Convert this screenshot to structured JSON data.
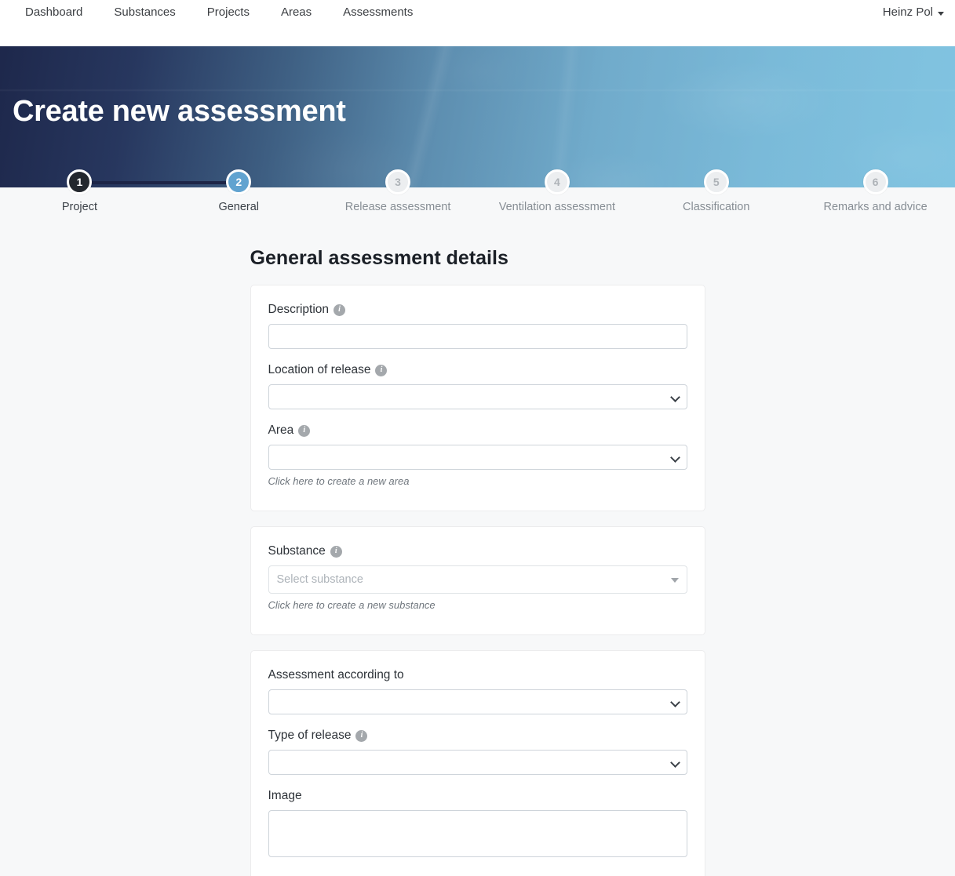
{
  "nav": {
    "items": [
      {
        "label": "Dashboard",
        "name": "nav-link-dashboard"
      },
      {
        "label": "Substances",
        "name": "nav-link-substances"
      },
      {
        "label": "Projects",
        "name": "nav-link-projects"
      },
      {
        "label": "Areas",
        "name": "nav-link-areas"
      },
      {
        "label": "Assessments",
        "name": "nav-link-assessments"
      }
    ],
    "user": "Heinz Pol",
    "user_caret_icon": "caret-down-icon"
  },
  "hero": {
    "title": "Create new assessment"
  },
  "stepper": {
    "steps": [
      {
        "number": "1",
        "label": "Project",
        "state": "done"
      },
      {
        "number": "2",
        "label": "General",
        "state": "active"
      },
      {
        "number": "3",
        "label": "Release assessment",
        "state": "todo"
      },
      {
        "number": "4",
        "label": "Ventilation assessment",
        "state": "todo"
      },
      {
        "number": "5",
        "label": "Classification",
        "state": "todo"
      },
      {
        "number": "6",
        "label": "Remarks and advice",
        "state": "todo"
      }
    ]
  },
  "main": {
    "page_title": "General assessment details",
    "card1": {
      "description": {
        "label": "Description",
        "info_icon": "info-icon",
        "value": ""
      },
      "location_of_release": {
        "label": "Location of release",
        "info_icon": "info-icon",
        "value": "",
        "chevron_icon": "chevron-down-icon"
      },
      "area": {
        "label": "Area",
        "info_icon": "info-icon",
        "value": "",
        "chevron_icon": "chevron-down-icon",
        "helper": "Click here to create a new area"
      }
    },
    "card2": {
      "substance": {
        "label": "Substance",
        "info_icon": "info-icon",
        "placeholder": "Select substance",
        "arrow_icon": "triangle-down-icon",
        "helper": "Click here to create a new substance"
      }
    },
    "card3": {
      "assessment_according_to": {
        "label": "Assessment according to",
        "value": "",
        "chevron_icon": "chevron-down-icon"
      },
      "type_of_release": {
        "label": "Type of release",
        "info_icon": "info-icon",
        "value": "",
        "chevron_icon": "chevron-down-icon"
      },
      "image": {
        "label": "Image",
        "value": ""
      }
    }
  },
  "colors": {
    "step_done": "#24282e",
    "step_active": "#61a3d0",
    "step_todo": "#eceef0",
    "hero_dark": "#1a2347",
    "hero_light": "#50b0d8",
    "page_bg": "#f7f8f9"
  }
}
